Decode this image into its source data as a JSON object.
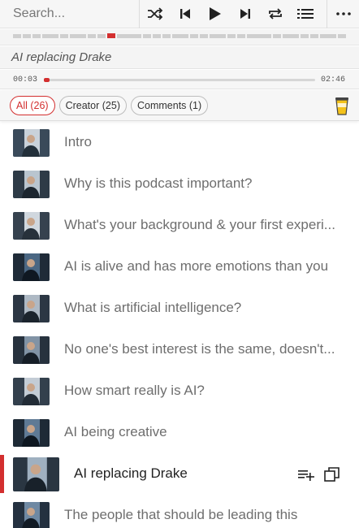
{
  "search": {
    "placeholder": "Search..."
  },
  "controls": [
    {
      "name": "shuffle-button",
      "icon": "shuffle-icon"
    },
    {
      "name": "previous-button",
      "icon": "skip-previous-icon"
    },
    {
      "name": "play-button",
      "icon": "play-icon"
    },
    {
      "name": "next-button",
      "icon": "skip-next-icon"
    },
    {
      "name": "repeat-button",
      "icon": "repeat-icon"
    },
    {
      "name": "chapter-list-button",
      "icon": "list-icon"
    }
  ],
  "more_icon": "more-horizontal-icon",
  "now_playing": {
    "title": "AI replacing Drake"
  },
  "progress": {
    "current": "00:03",
    "total": "02:46",
    "fraction": 0.02
  },
  "filters": [
    {
      "label": "All (26)",
      "active": true
    },
    {
      "label": "Creator (25)",
      "active": false
    },
    {
      "label": "Comments (1)",
      "active": false
    }
  ],
  "donate_icon": "cup-icon",
  "chapters": [
    {
      "title": "Intro"
    },
    {
      "title": "Why is this podcast important?"
    },
    {
      "title": "What's your background & your first experi..."
    },
    {
      "title": "AI is alive and has more emotions than you"
    },
    {
      "title": "What is artificial intelligence?"
    },
    {
      "title": "No one's best interest is the same, doesn't..."
    },
    {
      "title": "How smart really is AI?"
    },
    {
      "title": "AI being creative"
    },
    {
      "title": "AI replacing Drake",
      "current": true
    },
    {
      "title": "The people that should be leading this"
    }
  ],
  "current_actions": [
    {
      "name": "add-to-queue-button",
      "icon": "playlist-add-icon"
    },
    {
      "name": "open-in-new-button",
      "icon": "copy-icon"
    }
  ],
  "colors": {
    "accent": "#d32f2f",
    "bar_bg": "#f6f6f6",
    "text_muted": "#6e6e6e"
  }
}
